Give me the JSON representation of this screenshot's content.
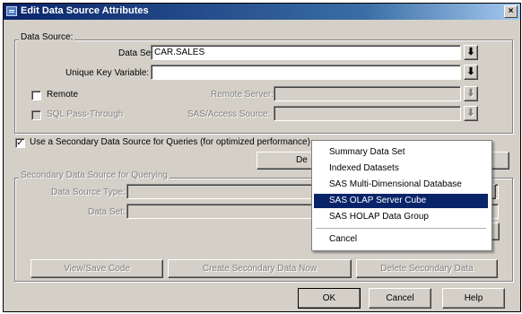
{
  "window": {
    "title": "Edit Data Source Attributes",
    "close_glyph": "×"
  },
  "data_source": {
    "legend": "Data Source:",
    "data_set_label": "Data Set:",
    "data_set_value": "CAR.SALES",
    "unique_key_label": "Unique Key Variable:",
    "unique_key_value": "",
    "remote_label": "Remote",
    "remote_server_label": "Remote Server:",
    "remote_server_value": "",
    "sql_label": "SQL Pass-Through",
    "sas_access_label": "SAS/Access Source:",
    "sas_access_value": "",
    "dropdown_glyph": "⬇"
  },
  "secondary_checkbox": {
    "label": "Use a Secondary Data Source for Queries (for optimized performance)",
    "checked": true,
    "check_glyph": "✓"
  },
  "define_button_partial": "De",
  "secondary": {
    "legend": "Secondary Data Source for Querying",
    "type_label": "Data Source Type:",
    "type_value": "",
    "data_set_label": "Data Set:",
    "data_set_value": ""
  },
  "bottom_buttons": {
    "view_save": "View/Save Code",
    "create": "Create Secondary Data Now",
    "delete": "Delete Secondary Data"
  },
  "dialog_buttons": {
    "ok": "OK",
    "cancel": "Cancel",
    "help": "Help"
  },
  "menu": {
    "items": [
      "Summary Data Set",
      "Indexed Datasets",
      "SAS Multi-Dimensional Database",
      "SAS OLAP Server Cube",
      "SAS HOLAP Data Group",
      "Cancel"
    ],
    "selected": "SAS OLAP Server Cube"
  },
  "colors": {
    "titlebar": "#0a246a",
    "dialog_face": "#d4d0c8",
    "selection": "#0a246a"
  }
}
